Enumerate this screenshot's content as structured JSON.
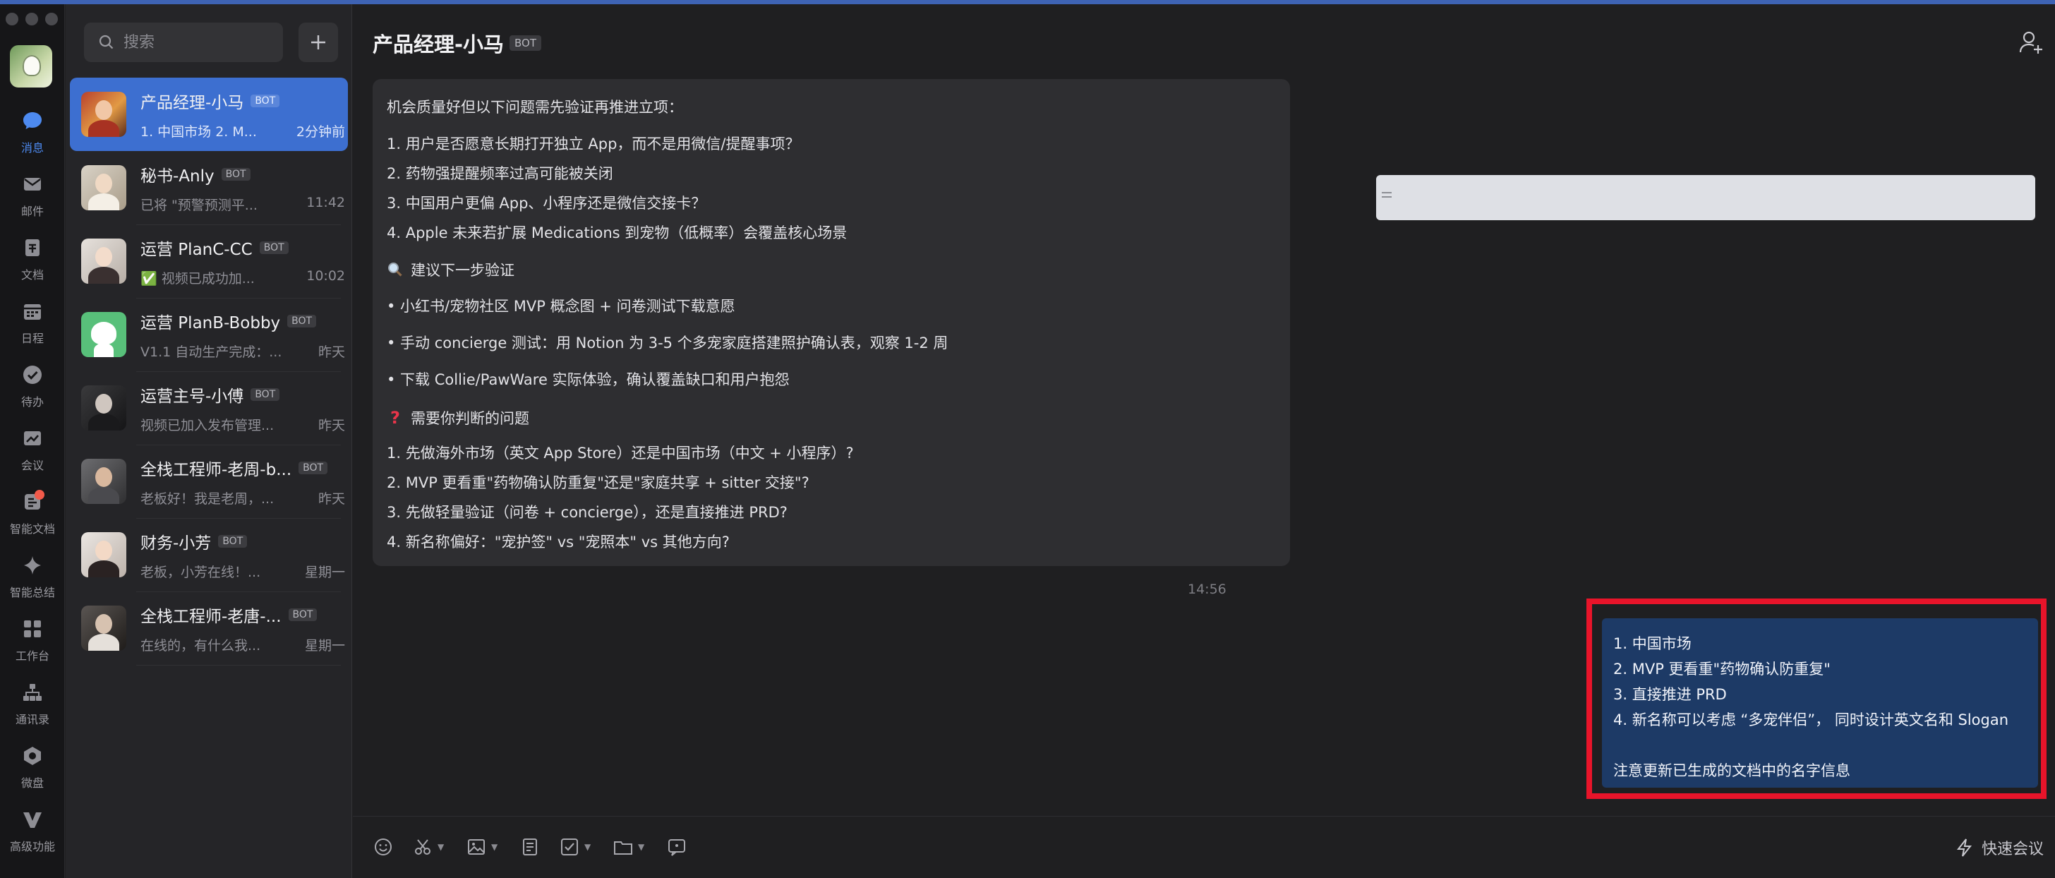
{
  "rail": {
    "items": [
      {
        "label": "消息",
        "icon": "chat-bubble-icon",
        "active": true
      },
      {
        "label": "邮件",
        "icon": "mail-icon"
      },
      {
        "label": "文档",
        "icon": "document-icon"
      },
      {
        "label": "日程",
        "icon": "calendar-icon"
      },
      {
        "label": "待办",
        "icon": "check-circle-icon"
      },
      {
        "label": "会议",
        "icon": "meeting-icon"
      },
      {
        "label": "智能文档",
        "icon": "smart-doc-icon",
        "dot": true
      },
      {
        "label": "智能总结",
        "icon": "sparkle-icon"
      },
      {
        "label": "工作台",
        "icon": "grid-icon"
      },
      {
        "label": "通讯录",
        "icon": "org-chart-icon"
      },
      {
        "label": "微盘",
        "icon": "drive-icon"
      },
      {
        "label": "高级功能",
        "icon": "advanced-icon"
      }
    ]
  },
  "search": {
    "placeholder": "搜索"
  },
  "chats": [
    {
      "name": "产品经理-小马",
      "badge": "BOT",
      "preview": "1. 中国市场 2. M...",
      "time": "2分钟前",
      "active": true
    },
    {
      "name": "秘书-Anly",
      "badge": "BOT",
      "preview": "已将 \"预警预测平...",
      "time": "11:42"
    },
    {
      "name": "运营 PlanC-CC",
      "badge": "BOT",
      "preview": "✅ 视频已成功加...",
      "time": "10:02"
    },
    {
      "name": "运营 PlanB-Bobby",
      "badge": "BOT",
      "preview": "V1.1 自动生产完成：...",
      "time": "昨天"
    },
    {
      "name": "运营主号-小傅",
      "badge": "BOT",
      "preview": "视频已加入发布管理...",
      "time": "昨天"
    },
    {
      "name": "全栈工程师-老周-b...",
      "badge": "BOT",
      "preview": "老板好！我是老周，...",
      "time": "昨天"
    },
    {
      "name": "财务-小芳",
      "badge": "BOT",
      "preview": "老板，小芳在线！...",
      "time": "星期一"
    },
    {
      "name": "全栈工程师-老唐-...",
      "badge": "BOT",
      "preview": "在线的，有什么我...",
      "time": "星期一"
    }
  ],
  "header": {
    "title": "产品经理-小马",
    "badge": "BOT"
  },
  "message_left": {
    "intro": "机会质量好但以下问题需先验证再推进立项：",
    "risks": [
      "1.  用户是否愿意长期打开独立 App，而不是用微信/提醒事项？",
      "2.  药物强提醒频率过高可能被关闭",
      "3.  中国用户更偏 App、小程序还是微信交接卡？",
      "4.  Apple 未来若扩展 Medications 到宠物（低概率）会覆盖核心场景"
    ],
    "next_title": "建议下一步验证",
    "next_items": [
      "• 小红书/宠物社区 MVP 概念图 + 问卷测试下载意愿",
      "• 手动 concierge 测试：用 Notion 为 3-5 个多宠家庭搭建照护确认表，观察 1-2 周",
      "• 下载 Collie/PawWare 实际体验，确认覆盖缺口和用户抱怨"
    ],
    "question_title": "需要你判断的问题",
    "questions": [
      "1.  先做海外市场（英文 App Store）还是中国市场（中文 + 小程序）?",
      "2.  MVP 更看重\"药物确认防重复\"还是\"家庭共享 + sitter 交接\"?",
      "3.  先做轻量验证（问卷 + concierge），还是直接推进 PRD?",
      "4.  新名称偏好：\"宠护签\" vs \"宠照本\" vs 其他方向?"
    ]
  },
  "message_time": "14:56",
  "message_right": {
    "lines": [
      "1. 中国市场",
      "2. MVP 更看重\"药物确认防重复\"",
      "3. 直接推进 PRD",
      "4. 新名称可以考虑 “多宠伴侣”， 同时设计英文名和 Slogan",
      "",
      "注意更新已生成的文档中的名字信息"
    ]
  },
  "composer": {
    "quick_meeting": "快速会议"
  },
  "colors": {
    "accent": "#3d6fd0",
    "highlight": "#e8142a",
    "user_bubble": "#1d3a66"
  }
}
